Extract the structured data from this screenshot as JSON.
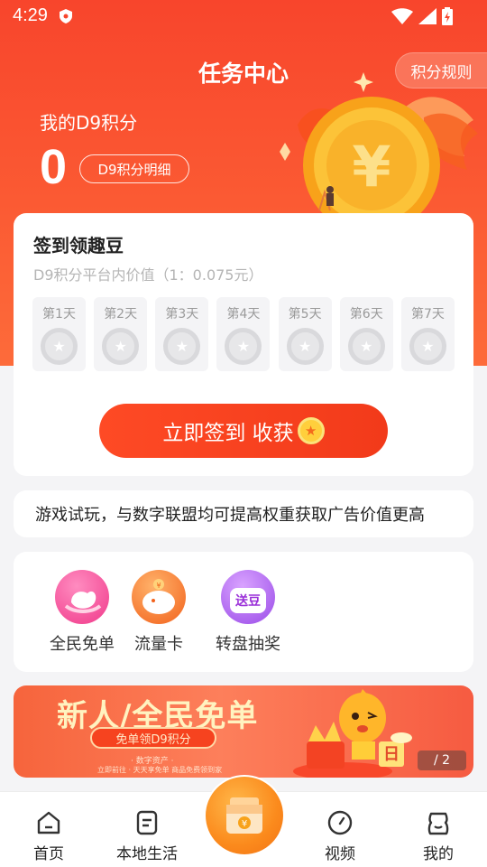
{
  "status_bar": {
    "time": "4:29"
  },
  "header": {
    "title": "任务中心",
    "rules_button": "积分规则"
  },
  "points": {
    "label": "我的D9积分",
    "value": "0",
    "detail_button": "D9积分明细"
  },
  "signin": {
    "title": "签到领趣豆",
    "subtitle": "D9积分平台内价值（1：0.075元）",
    "days": [
      {
        "label": "第1天"
      },
      {
        "label": "第2天"
      },
      {
        "label": "第3天"
      },
      {
        "label": "第4天"
      },
      {
        "label": "第5天"
      },
      {
        "label": "第6天"
      },
      {
        "label": "第7天"
      }
    ],
    "button": "立即签到 收获"
  },
  "notice": {
    "text": "游戏试玩，与数字联盟均可提高权重获取广告价值更高"
  },
  "features": [
    {
      "label": "全民免单",
      "icon": "free-order-icon"
    },
    {
      "label": "流量卡",
      "icon": "piggy-bank-icon"
    },
    {
      "label": "转盘抽奖",
      "icon": "lucky-wheel-icon",
      "badge": "送豆"
    }
  ],
  "banner": {
    "title": "新人/全民免单",
    "pill": "免单领D9积分",
    "tag": "· 数字资产 ·",
    "footnote": "立即前往 · 天天享免单 商品免费领到家",
    "page": "/ 2"
  },
  "nav": [
    {
      "label": "首页",
      "icon": "home-icon"
    },
    {
      "label": "本地生活",
      "icon": "document-icon"
    },
    {
      "label": "视频",
      "icon": "compass-icon"
    },
    {
      "label": "我的",
      "icon": "profile-icon"
    }
  ],
  "colors": {
    "primary": "#f8452c",
    "button": "#f23a1a",
    "background": "#f4f4f6"
  }
}
